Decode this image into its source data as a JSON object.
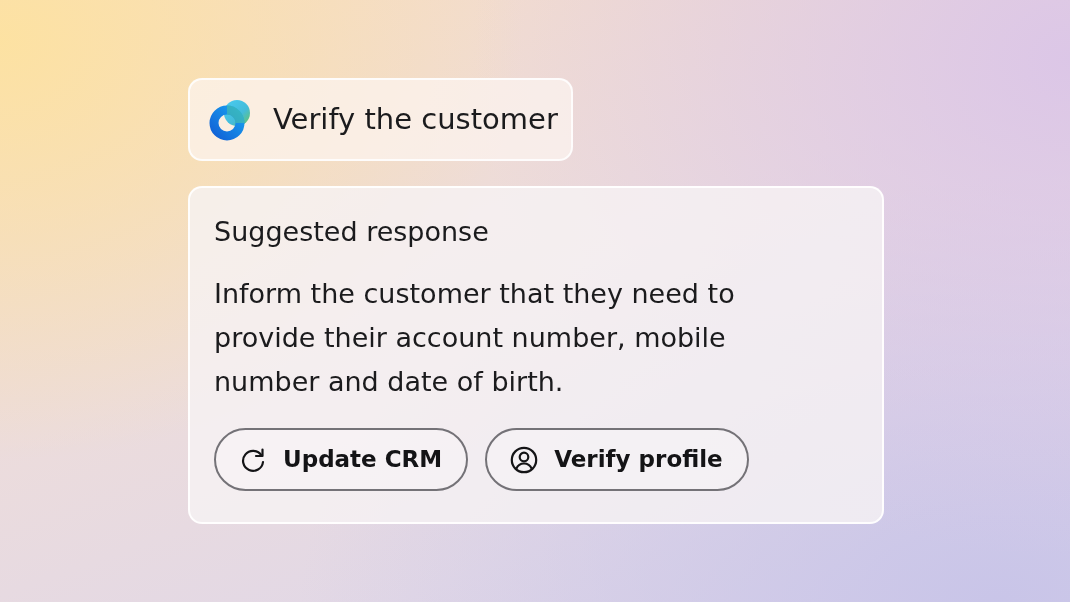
{
  "task_chip": {
    "title": "Verify the customer"
  },
  "suggestion_card": {
    "title": "Suggested response",
    "text": "Inform the customer that they need to provide their account number, mobile number and date of birth.",
    "actions": [
      {
        "kind": "refresh",
        "label": "Update CRM"
      },
      {
        "kind": "profile",
        "label": "Verify profile"
      }
    ]
  }
}
